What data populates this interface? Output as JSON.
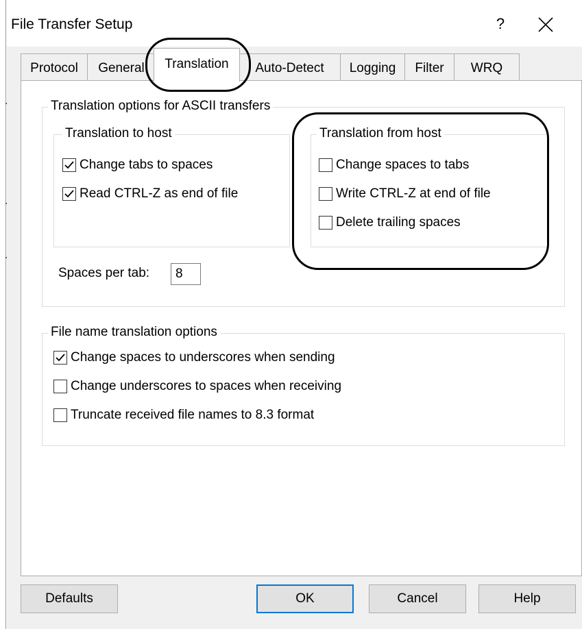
{
  "window": {
    "title": "File Transfer Setup",
    "help_glyph": "?",
    "close_icon": "close-icon"
  },
  "tabs": [
    {
      "label": "Protocol",
      "active": false
    },
    {
      "label": "General",
      "active": false
    },
    {
      "label": "Translation",
      "active": true
    },
    {
      "label": "Auto-Detect",
      "active": false
    },
    {
      "label": "Logging",
      "active": false
    },
    {
      "label": "Filter",
      "active": false
    },
    {
      "label": "WRQ",
      "active": false
    }
  ],
  "ascii_options": {
    "group_label": "Translation options for ASCII transfers",
    "to_host": {
      "label": "Translation to host",
      "items": [
        {
          "label": "Change tabs to spaces",
          "checked": true
        },
        {
          "label": "Read CTRL-Z as end of file",
          "checked": true
        }
      ]
    },
    "from_host": {
      "label": "Translation from host",
      "items": [
        {
          "label": "Change spaces to tabs",
          "checked": false
        },
        {
          "label": "Write CTRL-Z at end of file",
          "checked": false
        },
        {
          "label": "Delete trailing spaces",
          "checked": false
        }
      ]
    },
    "spaces_per_tab_label": "Spaces per tab:",
    "spaces_per_tab_value": "8"
  },
  "file_name_options": {
    "group_label": "File name translation options",
    "items": [
      {
        "label": "Change spaces to underscores when sending",
        "checked": true
      },
      {
        "label": "Change underscores to spaces when receiving",
        "checked": false
      },
      {
        "label": "Truncate received file names to 8.3 format",
        "checked": false
      }
    ]
  },
  "buttons": {
    "defaults": "Defaults",
    "ok": "OK",
    "cancel": "Cancel",
    "help": "Help"
  }
}
